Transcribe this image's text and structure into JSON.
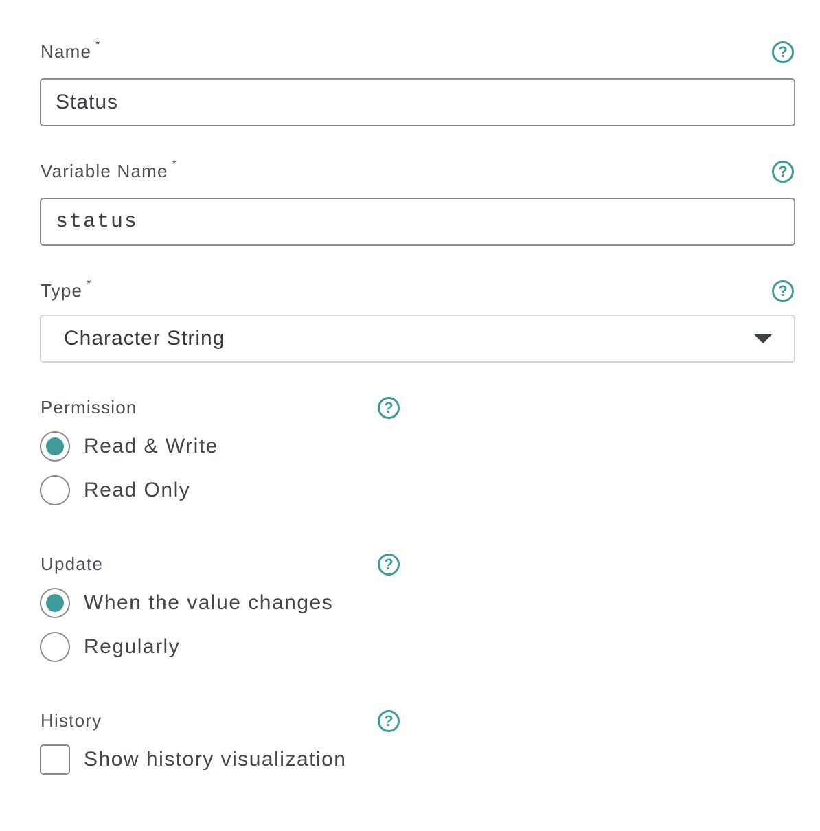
{
  "form": {
    "name": {
      "label": "Name",
      "required_mark": "*",
      "value": "Status",
      "help_icon": "?"
    },
    "variable_name": {
      "label": "Variable Name",
      "required_mark": "*",
      "value": "status",
      "help_icon": "?"
    },
    "type": {
      "label": "Type",
      "required_mark": "*",
      "selected": "Character String",
      "help_icon": "?"
    },
    "permission": {
      "label": "Permission",
      "help_icon": "?",
      "options": [
        {
          "label": "Read & Write",
          "checked": true
        },
        {
          "label": "Read Only",
          "checked": false
        }
      ]
    },
    "update": {
      "label": "Update",
      "help_icon": "?",
      "options": [
        {
          "label": "When the value changes",
          "checked": true
        },
        {
          "label": "Regularly",
          "checked": false
        }
      ]
    },
    "history": {
      "label": "History",
      "help_icon": "?",
      "checkbox_label": "Show history visualization",
      "checked": false
    }
  },
  "colors": {
    "accent": "#3f9a9a",
    "text": "#434a4f",
    "border": "#8a9196"
  }
}
